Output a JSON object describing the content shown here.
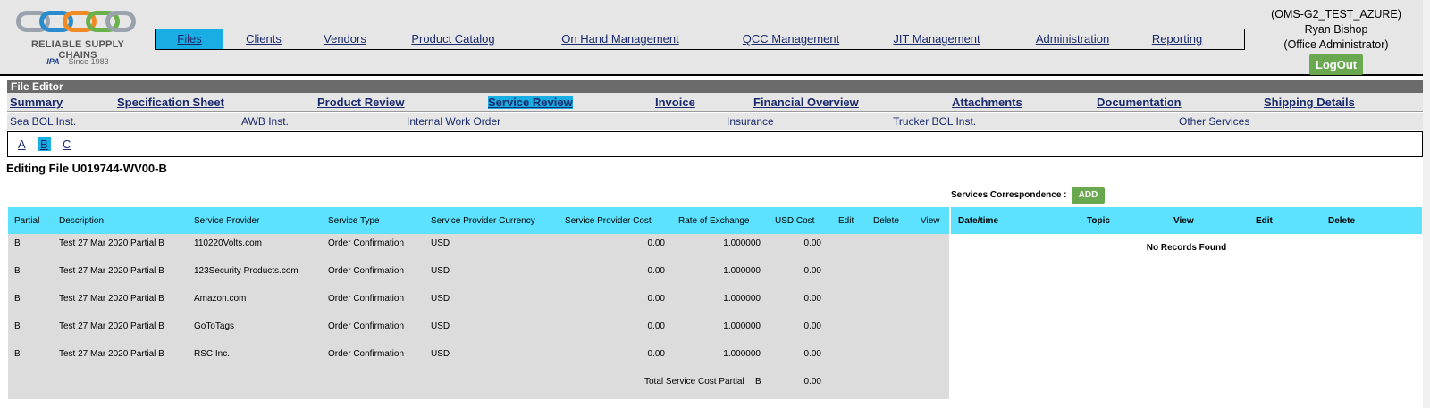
{
  "logo": {
    "brand": "RELIABLE SUPPLY CHAINS",
    "ipa": "IPA",
    "since": "Since 1983"
  },
  "main_nav": [
    "Files",
    "Clients",
    "Vendors",
    "Product Catalog",
    "On Hand Management",
    "QCC Management",
    "JIT Management",
    "Administration",
    "Reporting"
  ],
  "main_nav_active": "Files",
  "user": {
    "env": "(OMS-G2_TEST_AZURE)",
    "name": "Ryan Bishop",
    "role": "(Office Administrator)",
    "logout": "LogOut"
  },
  "file_editor": {
    "title": "File Editor",
    "tabs": [
      "Summary",
      "Specification Sheet",
      "Product Review",
      "Service Review",
      "Invoice",
      "Financial Overview",
      "Attachments",
      "Documentation",
      "Shipping Details"
    ],
    "active_tab": "Service Review",
    "subtabs": [
      "Sea BOL Inst.",
      "AWB Inst.",
      "Internal Work Order",
      "Insurance",
      "Trucker BOL Inst.",
      "Other Services"
    ],
    "partials": [
      "A",
      "B",
      "C"
    ],
    "active_partial": "B"
  },
  "editing_title": "Editing File U019744-WV00-B",
  "services": {
    "headers": [
      "Partial",
      "Description",
      "Service Provider",
      "Service Type",
      "Service Provider Currency",
      "Service Provider Cost",
      "Rate of Exchange",
      "USD Cost",
      "Edit",
      "Delete",
      "View"
    ],
    "rows": [
      {
        "partial": "B",
        "description": "Test 27 Mar 2020 Partial B",
        "provider": "110220Volts.com",
        "type": "Order Confirmation",
        "currency": "USD",
        "cost": "0.00",
        "rate": "1.000000",
        "usd": "0.00"
      },
      {
        "partial": "B",
        "description": "Test 27 Mar 2020 Partial B",
        "provider": "123Security Products.com",
        "type": "Order Confirmation",
        "currency": "USD",
        "cost": "0.00",
        "rate": "1.000000",
        "usd": "0.00"
      },
      {
        "partial": "B",
        "description": "Test 27 Mar 2020 Partial B",
        "provider": "Amazon.com",
        "type": "Order Confirmation",
        "currency": "USD",
        "cost": "0.00",
        "rate": "1.000000",
        "usd": "0.00"
      },
      {
        "partial": "B",
        "description": "Test 27 Mar 2020 Partial B",
        "provider": "GoToTags",
        "type": "Order Confirmation",
        "currency": "USD",
        "cost": "0.00",
        "rate": "1.000000",
        "usd": "0.00"
      },
      {
        "partial": "B",
        "description": "Test 27 Mar 2020 Partial B",
        "provider": "RSC Inc.",
        "type": "Order Confirmation",
        "currency": "USD",
        "cost": "0.00",
        "rate": "1.000000",
        "usd": "0.00"
      }
    ],
    "total_label": "Total Service Cost Partial",
    "total_partial": "B",
    "total_value": "0.00"
  },
  "correspondence": {
    "label": "Services Correspondence :",
    "add": "ADD",
    "headers": [
      "Date/time",
      "Topic",
      "View",
      "Edit",
      "Delete"
    ],
    "empty": "No Records Found"
  },
  "colors": {
    "header_bg": "#e6e6e6",
    "active": "#19aee3",
    "table_header": "#5ce1fe",
    "table_body": "#dcdcdc",
    "button": "#6aa84f",
    "editor_bar": "#6b6b6b"
  }
}
